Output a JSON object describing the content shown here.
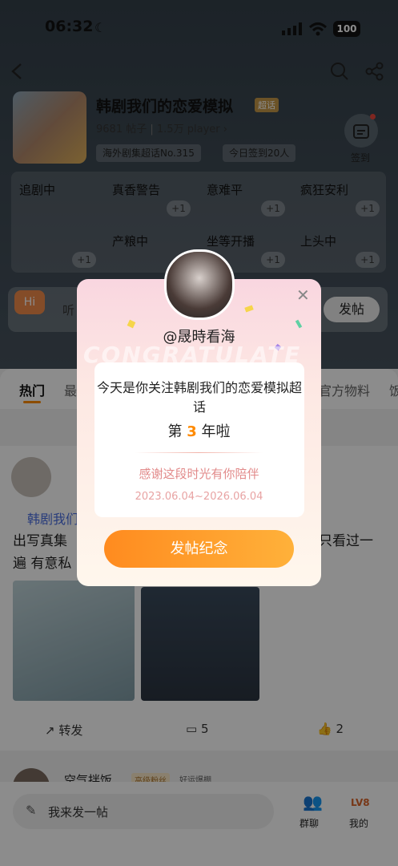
{
  "status": {
    "time": "06:32",
    "battery": "100"
  },
  "topic": {
    "title": "韩剧我们的恋爱模拟",
    "badge": "超话",
    "posts": "9681",
    "posts_unit": "帖子",
    "players": "1.5万",
    "players_unit": "player",
    "tag1": "海外剧集超话No.315",
    "tag2": "今日签到20人",
    "signin": "签到"
  },
  "grid": {
    "cells": [
      "追剧中",
      "真香警告",
      "意难平",
      "疯狂安利",
      "产粮中",
      "坐等开播",
      "上头中"
    ],
    "plus": "+1"
  },
  "hi_bar": {
    "hint": "听",
    "post": "发帖"
  },
  "tabs": [
    "热门",
    "最",
    "官方物料",
    "饭"
  ],
  "post": {
    "topic_tag": "韩剧我们",
    "line1": "出写真集",
    "line1_right": "只看过一",
    "line2": "遍 有意私",
    "repost": "转发",
    "comments": "5",
    "likes": "2"
  },
  "next_post": {
    "user": "空气拌饭_",
    "badge1": "高级粉丝",
    "badge2": "好运爆棚"
  },
  "bottom": {
    "input": "我来发一帖",
    "group": "群聊",
    "mine": "我的",
    "level": "LV8"
  },
  "modal": {
    "name": "@晟時看海",
    "message": "今天是你关注韩剧我们的恋爱模拟超话",
    "years_prefix": "第",
    "years_num": "3",
    "years_suffix": "年啦",
    "thanks": "感谢这段时光有你陪伴",
    "range": "2023.06.04~2026.06.04",
    "cta": "发帖纪念",
    "watermark": "CONGRATULATE"
  },
  "colors": {
    "accent": "#ff8a00",
    "cta_start": "#ff8b1f",
    "cta_end": "#ffb13a"
  }
}
